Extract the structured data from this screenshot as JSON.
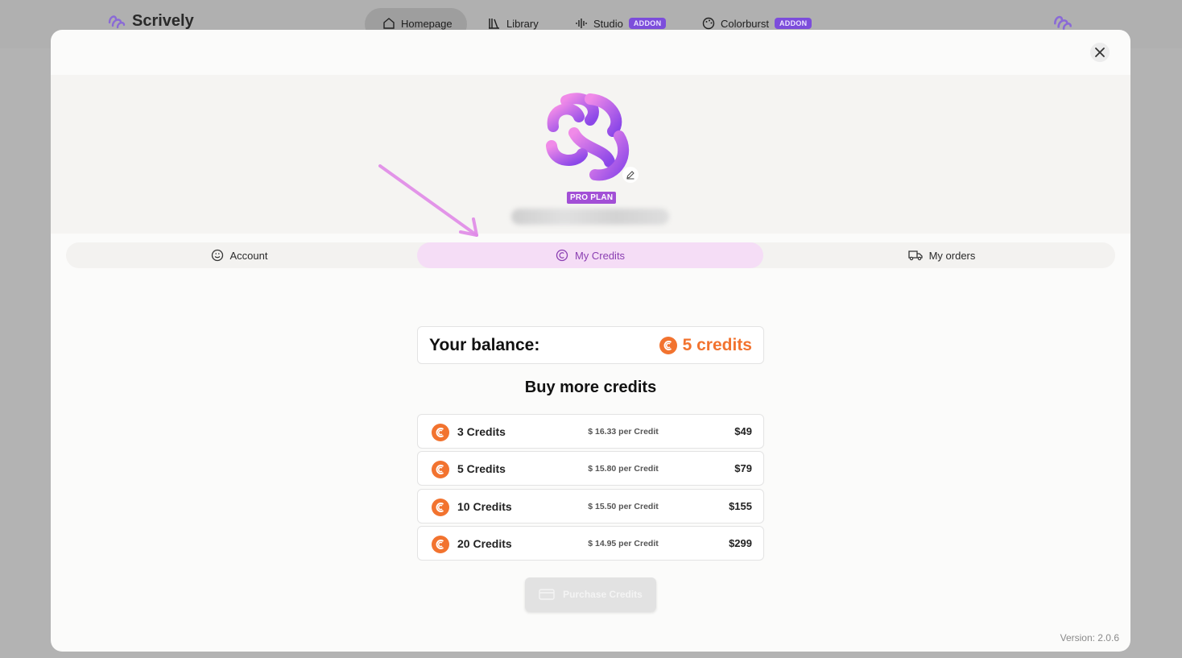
{
  "app": {
    "brand_name": "Scrively"
  },
  "nav": {
    "items": [
      {
        "label": "Homepage"
      },
      {
        "label": "Library"
      },
      {
        "label": "Studio",
        "badge": "ADDON"
      },
      {
        "label": "Colorburst",
        "badge": "ADDON"
      }
    ]
  },
  "profile": {
    "plan_badge": "PRO PLAN"
  },
  "tabs": [
    {
      "label": "Account"
    },
    {
      "label": "My Credits"
    },
    {
      "label": "My orders"
    }
  ],
  "balance": {
    "label": "Your balance:",
    "value": "5 credits"
  },
  "buy": {
    "title": "Buy more credits",
    "packages": [
      {
        "name": "3 Credits",
        "per": "$ 16.33 per Credit",
        "price": "$49"
      },
      {
        "name": "5 Credits",
        "per": "$ 15.80 per Credit",
        "price": "$79"
      },
      {
        "name": "10 Credits",
        "per": "$ 15.50 per Credit",
        "price": "$155"
      },
      {
        "name": "20 Credits",
        "per": "$ 14.95 per Credit",
        "price": "$299"
      }
    ],
    "purchase_label": "Purchase Credits"
  },
  "footer": {
    "version": "Version: 2.0.6"
  },
  "colors": {
    "accent": "#a24fd6",
    "credit_orange": "#f2732f",
    "tab_active_bg": "#f5ddf6"
  }
}
